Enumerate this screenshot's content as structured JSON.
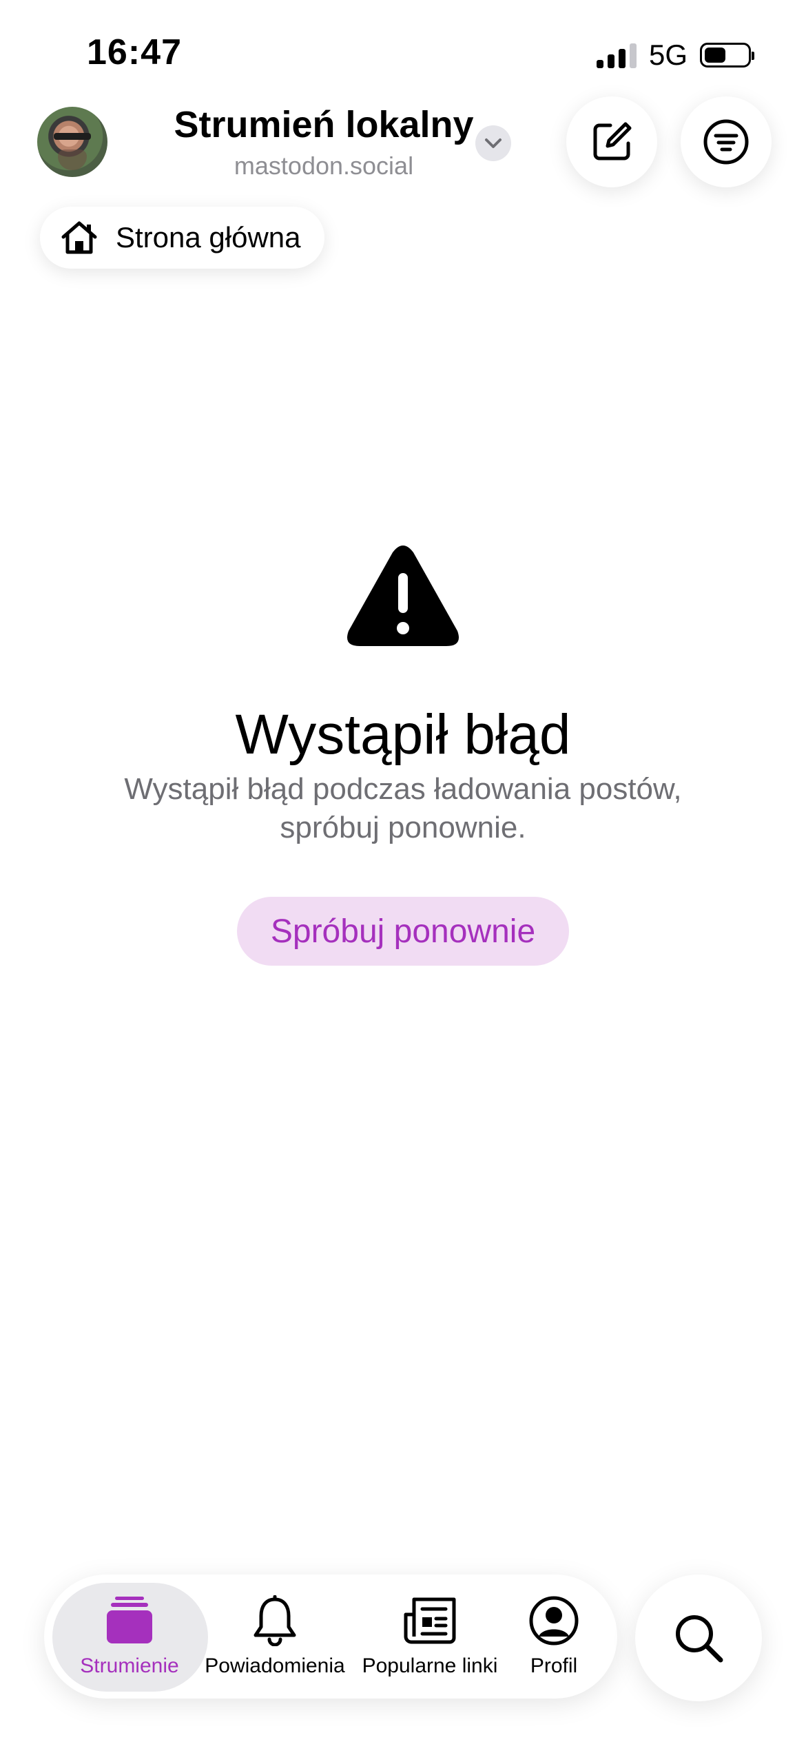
{
  "status_bar": {
    "time": "16:47",
    "network": "5G"
  },
  "header": {
    "title": "Strumień lokalny",
    "subtitle": "mastodon.social",
    "home_pill": "Strona główna"
  },
  "error": {
    "title": "Wystąpił błąd",
    "description": "Wystąpił błąd podczas ładowania postów, spróbuj ponownie.",
    "retry_label": "Spróbuj ponownie"
  },
  "tabbar": {
    "items": [
      {
        "label": "Strumienie",
        "icon": "timelines-icon",
        "active": true
      },
      {
        "label": "Powiadomienia",
        "icon": "bell-icon",
        "active": false
      },
      {
        "label": "Popularne linki",
        "icon": "newspaper-icon",
        "active": false
      },
      {
        "label": "Profil",
        "icon": "profile-icon",
        "active": false
      }
    ]
  },
  "colors": {
    "accent": "#a530bd",
    "accent_bg": "#f1dcf3",
    "muted": "#8e8e93"
  }
}
